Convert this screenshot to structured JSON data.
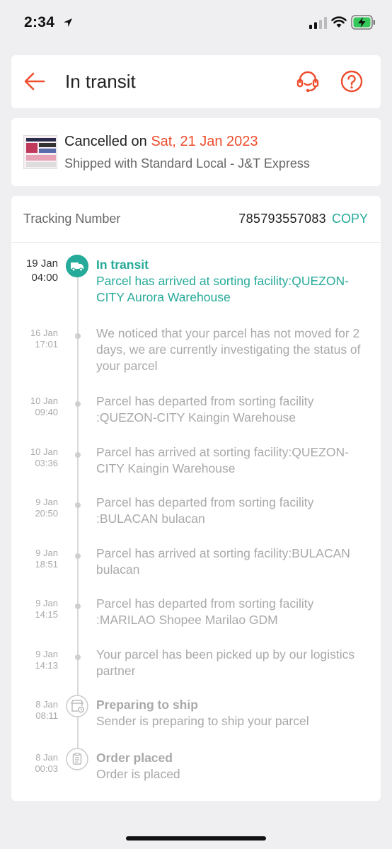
{
  "status_bar": {
    "time": "2:34"
  },
  "header": {
    "title": "In transit"
  },
  "order": {
    "cancel_prefix": "Cancelled on ",
    "cancel_date": "Sat, 21 Jan 2023",
    "shipping": "Shipped with Standard Local - J&T Express"
  },
  "tracking": {
    "label": "Tracking Number",
    "number": "785793557083",
    "copy": "COPY"
  },
  "events": [
    {
      "date": "19 Jan",
      "time": "04:00",
      "title": "In transit",
      "desc": "Parcel has arrived at sorting facility:QUEZON-CITY Aurora Warehouse"
    },
    {
      "date": "16 Jan",
      "time": "17:01",
      "desc": "We noticed that your parcel has not moved for 2 days, we are currently investigating the status of your parcel"
    },
    {
      "date": "10 Jan",
      "time": "09:40",
      "desc": "Parcel has departed from sorting facility :QUEZON-CITY Kaingin Warehouse"
    },
    {
      "date": "10 Jan",
      "time": "03:36",
      "desc": "Parcel has arrived at sorting facility:QUEZON-CITY Kaingin Warehouse"
    },
    {
      "date": "9 Jan",
      "time": "20:50",
      "desc": "Parcel has departed from sorting facility :BULACAN bulacan"
    },
    {
      "date": "9 Jan",
      "time": "18:51",
      "desc": "Parcel has arrived at sorting facility:BULACAN bulacan"
    },
    {
      "date": "9 Jan",
      "time": "14:15",
      "desc": "Parcel has departed from sorting facility :MARILAO Shopee Marilao GDM"
    },
    {
      "date": "9 Jan",
      "time": "14:13",
      "desc": "Your parcel has been picked up by our logistics partner"
    },
    {
      "date": "8 Jan",
      "time": "08:11",
      "title": "Preparing to ship",
      "desc": "Sender is preparing to ship your parcel"
    },
    {
      "date": "8 Jan",
      "time": "00:03",
      "title": "Order placed",
      "desc": "Order is placed"
    }
  ],
  "colors": {
    "accent": "#ee4d2d",
    "teal": "#26aa99"
  }
}
